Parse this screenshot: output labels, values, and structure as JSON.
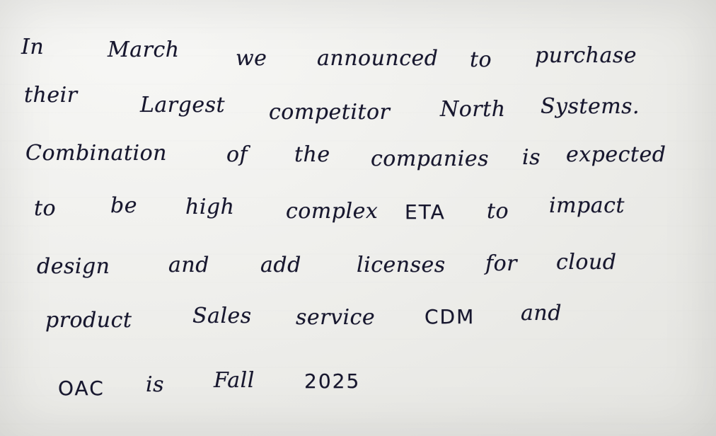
{
  "note": {
    "lines": [
      {
        "words": [
          "In",
          "March",
          "we",
          "announced",
          "to",
          "purchase"
        ]
      },
      {
        "words": [
          "their",
          "Largest",
          "competitor",
          "North",
          "Systems."
        ]
      },
      {
        "words": [
          "Combination",
          "of",
          "the",
          "companies",
          "is",
          "expected"
        ]
      },
      {
        "words": [
          "to",
          "be",
          "high",
          "complex",
          "ETA",
          "to",
          "impact"
        ]
      },
      {
        "words": [
          "design",
          "and",
          "add",
          "licenses",
          "for",
          "cloud"
        ]
      },
      {
        "words": [
          "product",
          "Sales",
          "service",
          "CDM",
          "and"
        ]
      },
      {
        "words": [
          "OAC",
          "is",
          "Fall",
          "2025"
        ]
      }
    ]
  },
  "colors": {
    "ink": "#17172e",
    "paper": "#efefec"
  }
}
